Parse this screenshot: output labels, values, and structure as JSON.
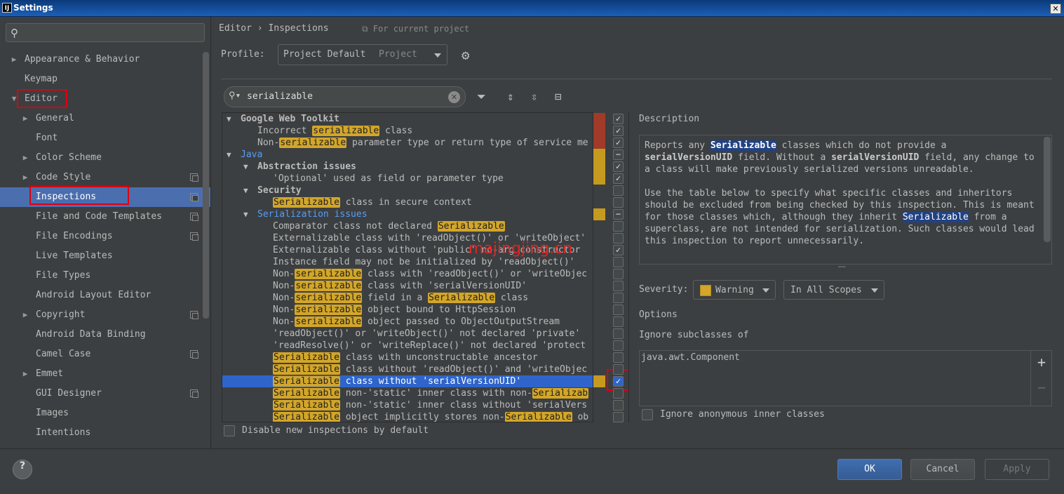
{
  "window": {
    "title": "Settings",
    "app_icon_text": "IJ"
  },
  "sidebar": {
    "items": [
      {
        "label": "Appearance & Behavior",
        "expandable": true,
        "expanded": false
      },
      {
        "label": "Keymap",
        "expandable": false
      },
      {
        "label": "Editor",
        "expandable": true,
        "expanded": true
      },
      {
        "label": "General",
        "expandable": true,
        "expanded": false
      },
      {
        "label": "Font",
        "expandable": false
      },
      {
        "label": "Color Scheme",
        "expandable": true,
        "expanded": false
      },
      {
        "label": "Code Style",
        "expandable": true,
        "expanded": false,
        "project": true
      },
      {
        "label": "Inspections",
        "expandable": false,
        "selected": true,
        "project": true
      },
      {
        "label": "File and Code Templates",
        "expandable": false,
        "project": true
      },
      {
        "label": "File Encodings",
        "expandable": false,
        "project": true
      },
      {
        "label": "Live Templates",
        "expandable": false
      },
      {
        "label": "File Types",
        "expandable": false
      },
      {
        "label": "Android Layout Editor",
        "expandable": false
      },
      {
        "label": "Copyright",
        "expandable": true,
        "expanded": false,
        "project": true
      },
      {
        "label": "Android Data Binding",
        "expandable": false
      },
      {
        "label": "Camel Case",
        "expandable": false,
        "project": true
      },
      {
        "label": "Emmet",
        "expandable": true,
        "expanded": false
      },
      {
        "label": "GUI Designer",
        "expandable": false,
        "project": true
      },
      {
        "label": "Images",
        "expandable": false
      },
      {
        "label": "Intentions",
        "expandable": false
      }
    ]
  },
  "header": {
    "breadcrumb": "Editor › Inspections",
    "for_project": "For current project",
    "profile_label": "Profile:",
    "profile_value": "Project Default",
    "profile_scope": "Project"
  },
  "inspection_search": {
    "value": "serializable"
  },
  "tree": {
    "rows": [
      {
        "level": 0,
        "toggle": "▼",
        "bold": true,
        "parts": [
          [
            "Google Web Toolkit",
            false
          ]
        ],
        "check": "✓",
        "sev": "#a23a2a"
      },
      {
        "level": 1,
        "parts": [
          [
            "Incorrect ",
            false
          ],
          [
            "serializable",
            true
          ],
          [
            " class",
            false
          ]
        ],
        "check": "✓",
        "sev": "#a23a2a"
      },
      {
        "level": 1,
        "parts": [
          [
            "Non-",
            false
          ],
          [
            "serializable",
            true
          ],
          [
            " parameter type or return type of service me",
            false
          ]
        ],
        "check": "✓",
        "sev": "#a23a2a"
      },
      {
        "level": 0,
        "toggle": "▼",
        "blue": true,
        "parts": [
          [
            "Java",
            false
          ]
        ],
        "check": "−",
        "sev": "#c59a1f"
      },
      {
        "level": 1,
        "toggle": "▼",
        "bold": true,
        "parts": [
          [
            "Abstraction issues",
            false
          ]
        ],
        "check": "✓",
        "sev": "#c59a1f"
      },
      {
        "level": 2,
        "parts": [
          [
            "'Optional' used as field or parameter type",
            false
          ]
        ],
        "check": "✓",
        "sev": "#c59a1f"
      },
      {
        "level": 1,
        "toggle": "▼",
        "bold": true,
        "parts": [
          [
            "Security",
            false
          ]
        ],
        "check": "",
        "sev": ""
      },
      {
        "level": 2,
        "parts": [
          [
            "Serializable",
            true
          ],
          [
            " class in secure context",
            false
          ]
        ],
        "check": "",
        "sev": ""
      },
      {
        "level": 1,
        "toggle": "▼",
        "blue": true,
        "parts": [
          [
            "Serialization issues",
            false
          ]
        ],
        "check": "−",
        "sev": "#c59a1f"
      },
      {
        "level": 2,
        "parts": [
          [
            "Comparator class not declared ",
            false
          ],
          [
            "Serializable",
            true
          ]
        ],
        "check": "",
        "sev": ""
      },
      {
        "level": 2,
        "parts": [
          [
            "Externalizable class with 'readObject()' or 'writeObject'",
            false
          ]
        ],
        "check": "",
        "sev": ""
      },
      {
        "level": 2,
        "parts": [
          [
            "Externalizable class without 'public' no-arg constructor",
            false
          ]
        ],
        "check": "✓",
        "sev": ""
      },
      {
        "level": 2,
        "parts": [
          [
            "Instance field may not be initialized by 'readObject()'",
            false
          ]
        ],
        "check": "",
        "sev": ""
      },
      {
        "level": 2,
        "parts": [
          [
            "Non-",
            false
          ],
          [
            "serializable",
            true
          ],
          [
            " class with 'readObject()' or 'writeObjec",
            false
          ]
        ],
        "check": "",
        "sev": ""
      },
      {
        "level": 2,
        "parts": [
          [
            "Non-",
            false
          ],
          [
            "serializable",
            true
          ],
          [
            " class with 'serialVersionUID'",
            false
          ]
        ],
        "check": "",
        "sev": ""
      },
      {
        "level": 2,
        "parts": [
          [
            "Non-",
            false
          ],
          [
            "serializable",
            true
          ],
          [
            " field in a ",
            false
          ],
          [
            "Serializable",
            true
          ],
          [
            " class",
            false
          ]
        ],
        "check": "",
        "sev": ""
      },
      {
        "level": 2,
        "parts": [
          [
            "Non-",
            false
          ],
          [
            "serializable",
            true
          ],
          [
            " object bound to HttpSession",
            false
          ]
        ],
        "check": "",
        "sev": ""
      },
      {
        "level": 2,
        "parts": [
          [
            "Non-",
            false
          ],
          [
            "serializable",
            true
          ],
          [
            " object passed to ObjectOutputStream",
            false
          ]
        ],
        "check": "",
        "sev": ""
      },
      {
        "level": 2,
        "parts": [
          [
            "'readObject()' or 'writeObject()' not declared 'private'",
            false
          ]
        ],
        "check": "",
        "sev": ""
      },
      {
        "level": 2,
        "parts": [
          [
            "'readResolve()' or 'writeReplace()' not declared 'protect",
            false
          ]
        ],
        "check": "",
        "sev": ""
      },
      {
        "level": 2,
        "parts": [
          [
            "Serializable",
            true
          ],
          [
            " class with unconstructable ancestor",
            false
          ]
        ],
        "check": "",
        "sev": ""
      },
      {
        "level": 2,
        "parts": [
          [
            "Serializable",
            true
          ],
          [
            " class without 'readObject()' and 'writeObjec",
            false
          ]
        ],
        "check": "",
        "sev": ""
      },
      {
        "level": 2,
        "selected": true,
        "parts": [
          [
            "Serializable",
            true
          ],
          [
            " class without 'serialVersionUID'",
            false
          ]
        ],
        "check": "✓",
        "sev": "#c59a1f"
      },
      {
        "level": 2,
        "parts": [
          [
            "Serializable",
            true
          ],
          [
            " non-'static' inner class with non-",
            false
          ],
          [
            "Serializab",
            true
          ]
        ],
        "check": "",
        "sev": ""
      },
      {
        "level": 2,
        "parts": [
          [
            "Serializable",
            true
          ],
          [
            " non-'static' inner class without 'serialVers",
            false
          ]
        ],
        "check": "",
        "sev": ""
      },
      {
        "level": 2,
        "parts": [
          [
            "Serializable",
            true
          ],
          [
            " object implicitly stores non-",
            false
          ],
          [
            "Serializable",
            true
          ],
          [
            " ob",
            false
          ]
        ],
        "check": "",
        "sev": ""
      }
    ]
  },
  "description": {
    "label": "Description",
    "p1": [
      "Reports any ",
      "Serializable",
      " classes which do not provide a ",
      "serialVersionUID",
      " field. Without a ",
      "serialVersionUID",
      " field, any change to a class will make previously serialized versions unreadable."
    ],
    "p2": [
      "Use the table below to specify what specific classes and inheritors should be excluded from being checked by this inspection. This is meant for those classes which, although they inherit ",
      "Serializable",
      " from a superclass, are not intended for serialization. Such classes would lead this inspection to report unnecessarily."
    ]
  },
  "severity": {
    "label": "Severity:",
    "value": "Warning",
    "color": "#d3a629",
    "scope": "In All Scopes"
  },
  "options": {
    "label": "Options",
    "ignore_label": "Ignore subclasses of",
    "ignore_items": [
      "java.awt.Component"
    ],
    "anon_label": "Ignore anonymous inner classes"
  },
  "disable_label": "Disable new inspections by default",
  "buttons": {
    "ok": "OK",
    "cancel": "Cancel",
    "apply": "Apply",
    "help": "?"
  },
  "watermark": "majingjing.cn"
}
